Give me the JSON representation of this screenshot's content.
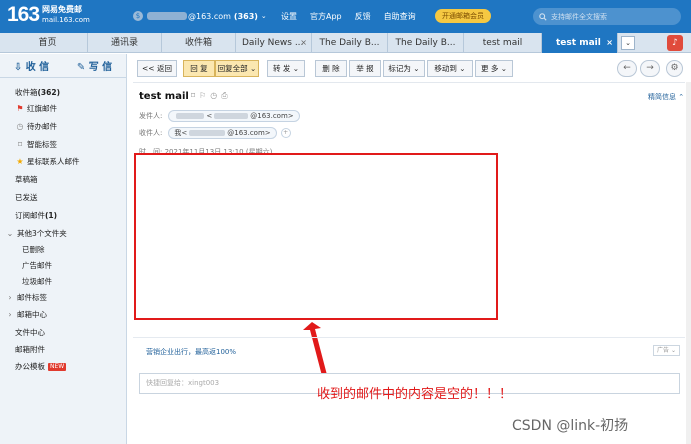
{
  "header": {
    "logo_number": "163",
    "logo_title": "网易免费邮",
    "logo_domain": "mail.163.com",
    "account_suffix": "@163.com",
    "unread_count": "(363)",
    "nav": [
      "设置",
      "官方App",
      "反馈",
      "自助查询"
    ],
    "vip_button": "开通邮箱会员",
    "search_placeholder": "支持邮件全文搜索"
  },
  "tabs": [
    {
      "label": "首页"
    },
    {
      "label": "通讯录"
    },
    {
      "label": "收件箱"
    },
    {
      "label": "Daily News ...",
      "closable": true
    },
    {
      "label": "The Daily B..."
    },
    {
      "label": "The Daily B..."
    },
    {
      "label": "test mail"
    },
    {
      "label": "test mail",
      "active": true,
      "closable": true
    }
  ],
  "sidebar": {
    "receive": "收 信",
    "compose": "写 信",
    "items": [
      {
        "label": "收件箱",
        "count": "(362)",
        "icon": "inbox"
      },
      {
        "label": "红旗邮件",
        "icon": "red-flag"
      },
      {
        "label": "待办邮件",
        "icon": "clock"
      },
      {
        "label": "智能标签",
        "icon": "tag"
      },
      {
        "label": "星标联系人邮件",
        "icon": "star"
      },
      {
        "label": "草稿箱"
      },
      {
        "label": "已发送"
      },
      {
        "label": "订阅邮件",
        "count": "(1)"
      },
      {
        "label": "其他3个文件夹",
        "icon": "chevron-down"
      },
      {
        "label": "已删除"
      },
      {
        "label": "广告邮件"
      },
      {
        "label": "垃圾邮件"
      },
      {
        "label": "邮件标签",
        "icon": "chevron-right"
      },
      {
        "label": "邮箱中心",
        "icon": "chevron-right"
      },
      {
        "label": "文件中心"
      },
      {
        "label": "邮箱附件"
      },
      {
        "label": "办公模板",
        "badge": "NEW"
      }
    ]
  },
  "toolbar": {
    "back": "<< 返回",
    "reply": "回 复",
    "reply_all": "回复全部",
    "forward": "转 发",
    "delete": "删 除",
    "report": "举 报",
    "mark": "标记为",
    "move": "移动到",
    "more": "更 多"
  },
  "mail": {
    "subject": "test mail",
    "details_link": "精简信息",
    "from_label": "发件人:",
    "from_suffix": "@163.com>",
    "to_label": "收件人:",
    "to_prefix": "我<",
    "to_suffix": "@163.com>",
    "time_text": "时　间: 2021年11月13日 13:10 (星期六)",
    "ad_text": "营销企业出行，最高返100%",
    "ad_tag": "广告",
    "quick_reply_placeholder": "快捷回复给：xingt003"
  },
  "annotation": "收到的邮件中的内容是空的！！！",
  "watermark": "CSDN @link-初扬",
  "colors": {
    "brand": "#1f76c2",
    "highlight": "#e11a1a"
  }
}
